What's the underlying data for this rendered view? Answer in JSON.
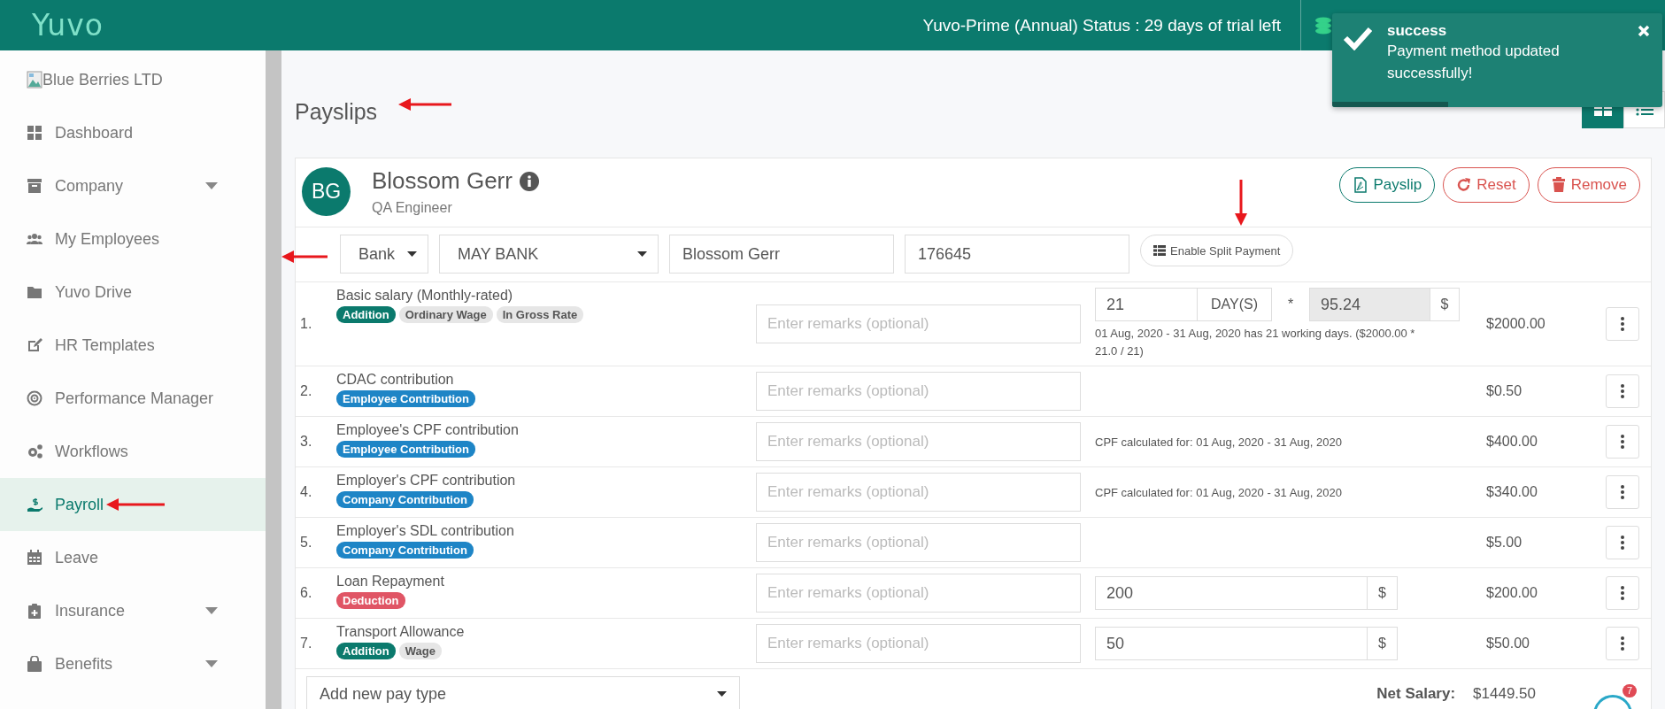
{
  "topbar": {
    "logo": "Yuvo",
    "status": "Yuvo-Prime (Annual) Status : 29 days of trial left"
  },
  "toast": {
    "title": "success",
    "message": "Payment method updated successfully!",
    "level": 0.35
  },
  "view_toggle": [
    {
      "selected": true
    },
    {
      "selected": false
    }
  ],
  "sidebar": {
    "company": "Blue Berries LTD",
    "items": [
      {
        "label": "Dashboard",
        "selected": false,
        "submenu": false
      },
      {
        "label": "Company",
        "selected": false,
        "submenu": true
      },
      {
        "label": "My Employees",
        "selected": false,
        "submenu": false
      },
      {
        "label": "Yuvo Drive",
        "selected": false,
        "submenu": false
      },
      {
        "label": "HR Templates",
        "selected": false,
        "submenu": false
      },
      {
        "label": "Performance Manager",
        "selected": false,
        "submenu": false
      },
      {
        "label": "Workflows",
        "selected": false,
        "submenu": false
      },
      {
        "label": "Payroll",
        "selected": true,
        "submenu": false
      },
      {
        "label": "Leave",
        "selected": false,
        "submenu": false
      },
      {
        "label": "Insurance",
        "selected": false,
        "submenu": true
      },
      {
        "label": "Benefits",
        "selected": false,
        "submenu": true
      }
    ]
  },
  "page": {
    "title": "Payslips"
  },
  "employee": {
    "initials": "BG",
    "name": "Blossom Gerr",
    "role": "QA Engineer",
    "buttons": [
      {
        "label": "Payslip",
        "kind": "primary"
      },
      {
        "label": "Reset",
        "kind": "danger"
      },
      {
        "label": "Remove",
        "kind": "danger"
      }
    ]
  },
  "payment": {
    "method": "Bank",
    "bank": "MAY BANK",
    "account_name": "Blossom Gerr",
    "account_number": "176645",
    "split_button": "Enable Split Payment"
  },
  "pay_items": [
    {
      "index": "1.",
      "name": "Basic salary (Monthly-rated)",
      "tags": [
        {
          "label": "Addition",
          "color": "#0b7a6d"
        },
        {
          "label": "Ordinary Wage",
          "color": "#e6e6e6"
        },
        {
          "label": "In Gross Rate",
          "color": "#e6e6e6"
        }
      ],
      "placeholder": "Enter remarks (optional)",
      "kind": "days",
      "value": "21",
      "unit": "DAY(S)",
      "operator": "*",
      "rate": "95.24",
      "currency": "$",
      "note": "01 Aug, 2020 - 31 Aug, 2020 has 21 working days. ($2000.00 * 21.0 / 21)",
      "amount": "$2000.00"
    },
    {
      "index": "2.",
      "name": "CDAC contribution",
      "tags": [
        {
          "label": "Employee Contribution",
          "color": "#1e85c6"
        }
      ],
      "placeholder": "Enter remarks (optional)",
      "kind": "plain",
      "amount": "$0.50"
    },
    {
      "index": "3.",
      "name": "Employee's CPF contribution",
      "tags": [
        {
          "label": "Employee Contribution",
          "color": "#1e85c6"
        }
      ],
      "placeholder": "Enter remarks (optional)",
      "kind": "note",
      "note": "CPF calculated for: 01 Aug, 2020 - 31 Aug, 2020",
      "amount": "$400.00"
    },
    {
      "index": "4.",
      "name": "Employer's CPF contribution",
      "tags": [
        {
          "label": "Company Contribution",
          "color": "#1e85c6"
        }
      ],
      "placeholder": "Enter remarks (optional)",
      "kind": "note",
      "note": "CPF calculated for: 01 Aug, 2020 - 31 Aug, 2020",
      "amount": "$340.00"
    },
    {
      "index": "5.",
      "name": "Employer's SDL contribution",
      "tags": [
        {
          "label": "Company Contribution",
          "color": "#1e85c6"
        }
      ],
      "placeholder": "Enter remarks (optional)",
      "kind": "plain",
      "amount": "$5.00"
    },
    {
      "index": "6.",
      "name": "Loan Repayment",
      "tags": [
        {
          "label": "Deduction",
          "color": "#e05565"
        }
      ],
      "placeholder": "Enter remarks (optional)",
      "kind": "input",
      "value": "200",
      "currency": "$",
      "amount": "$200.00"
    },
    {
      "index": "7.",
      "name": "Transport Allowance",
      "tags": [
        {
          "label": "Addition",
          "color": "#0b7a6d"
        },
        {
          "label": "Wage",
          "color": "#e6e6e6"
        }
      ],
      "placeholder": "Enter remarks (optional)",
      "kind": "input",
      "value": "50",
      "currency": "$",
      "amount": "$50.00"
    }
  ],
  "add_pay_type": {
    "placeholder": "Add new pay type"
  },
  "net_salary": {
    "label": "Net Salary:",
    "value": "$1449.50"
  },
  "chat": {
    "badge": "7"
  }
}
